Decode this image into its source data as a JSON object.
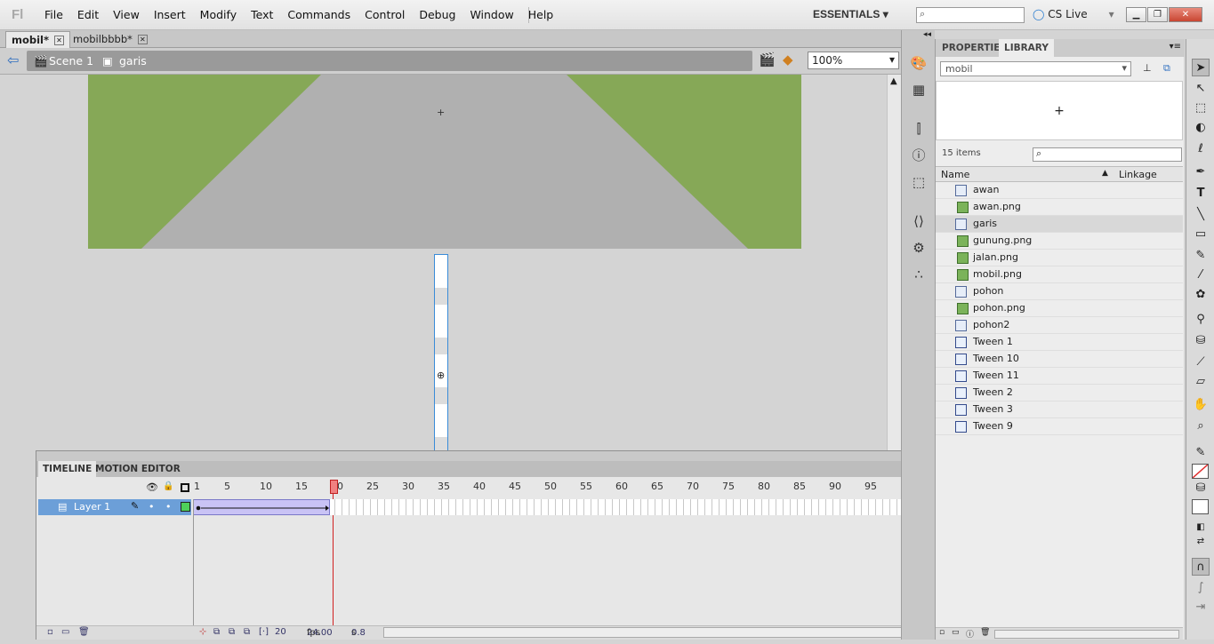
{
  "app": {
    "logo": "Fl"
  },
  "menu": [
    "File",
    "Edit",
    "View",
    "Insert",
    "Modify",
    "Text",
    "Commands",
    "Control",
    "Debug",
    "Window",
    "Help"
  ],
  "workspace": {
    "label": "ESSENTIALS"
  },
  "cslive": {
    "label": "CS Live"
  },
  "doc_tabs": [
    {
      "label": "mobil*"
    },
    {
      "label": "mobilbbbb*"
    }
  ],
  "breadcrumb": {
    "scene": "Scene 1",
    "symbol": "garis"
  },
  "zoom": {
    "value": "100%"
  },
  "timeline": {
    "tabs": [
      "TIMELINE",
      "MOTION EDITOR"
    ],
    "frame_numbers": [
      "1",
      "5",
      "10",
      "15",
      "20",
      "25",
      "30",
      "35",
      "40",
      "45",
      "50",
      "55",
      "60",
      "65",
      "70",
      "75",
      "80",
      "85",
      "90",
      "95",
      "10"
    ],
    "current_frame_marker": "20",
    "layer": {
      "name": "Layer 1"
    },
    "footer": {
      "frame": "20",
      "fps": "24.00",
      "fps_unit": "fps",
      "time": "0.8",
      "time_unit": "s"
    }
  },
  "library": {
    "tabs": [
      "PROPERTIES",
      "LIBRARY"
    ],
    "document": "mobil",
    "count": "15 items",
    "columns": {
      "name": "Name",
      "linkage": "Linkage"
    },
    "items": [
      {
        "name": "awan",
        "type": "movieclip"
      },
      {
        "name": "awan.png",
        "type": "bitmap"
      },
      {
        "name": "garis",
        "type": "movieclip"
      },
      {
        "name": "gunung.png",
        "type": "bitmap"
      },
      {
        "name": "jalan.png",
        "type": "bitmap"
      },
      {
        "name": "mobil.png",
        "type": "bitmap"
      },
      {
        "name": "pohon",
        "type": "movieclip"
      },
      {
        "name": "pohon.png",
        "type": "bitmap"
      },
      {
        "name": "pohon2",
        "type": "movieclip"
      },
      {
        "name": "Tween 1",
        "type": "graphic"
      },
      {
        "name": "Tween 10",
        "type": "graphic"
      },
      {
        "name": "Tween 11",
        "type": "graphic"
      },
      {
        "name": "Tween 2",
        "type": "graphic"
      },
      {
        "name": "Tween 3",
        "type": "graphic"
      },
      {
        "name": "Tween 9",
        "type": "graphic"
      }
    ]
  },
  "colors": {
    "accent": "#6c9fd8",
    "playhead": "#d02020",
    "tween": "#c9c3f5"
  }
}
